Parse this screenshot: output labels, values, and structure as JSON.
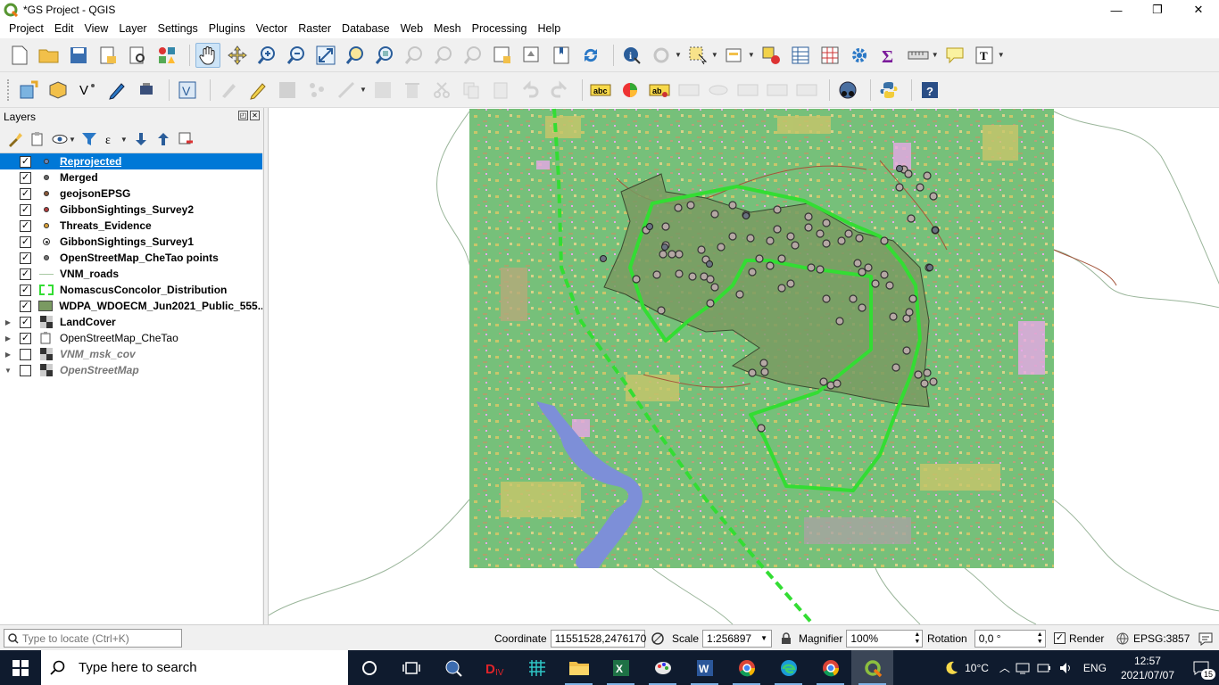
{
  "window": {
    "title": "*GS Project - QGIS",
    "minimize_glyph": "—",
    "maximize_glyph": "❐",
    "close_glyph": "✕"
  },
  "menubar": {
    "items": [
      "Project",
      "Edit",
      "View",
      "Layer",
      "Settings",
      "Plugins",
      "Vector",
      "Raster",
      "Database",
      "Web",
      "Mesh",
      "Processing",
      "Help"
    ]
  },
  "layers_panel": {
    "title": "Layers",
    "layers": [
      {
        "name": "Reprojected",
        "checked": true,
        "symbol": "dot",
        "color": "#6b86b6",
        "selected": true,
        "expander": ""
      },
      {
        "name": "Merged",
        "checked": true,
        "symbol": "dot",
        "color": "#6b6b6b",
        "expander": ""
      },
      {
        "name": "geojsonEPSG",
        "checked": true,
        "symbol": "dot",
        "color": "#8a5a3a",
        "expander": ""
      },
      {
        "name": "GibbonSightings_Survey2",
        "checked": true,
        "symbol": "dot",
        "color": "#b33d3d",
        "expander": ""
      },
      {
        "name": "Threats_Evidence",
        "checked": true,
        "symbol": "dot",
        "color": "#d9a13a",
        "expander": ""
      },
      {
        "name": "GibbonSightings_Survey1",
        "checked": true,
        "symbol": "ring",
        "color": "#555555",
        "expander": ""
      },
      {
        "name": "OpenStreetMap_CheTao points",
        "checked": true,
        "symbol": "dot",
        "color": "#777777",
        "expander": ""
      },
      {
        "name": "VNM_roads",
        "checked": true,
        "symbol": "line",
        "color": "#a9c9a4",
        "expander": ""
      },
      {
        "name": "NomascusConcolor_Distribution",
        "checked": true,
        "symbol": "dashbox",
        "color": "#33dd33",
        "expander": ""
      },
      {
        "name": "WDPA_WDOECM_Jun2021_Public_555...",
        "checked": true,
        "symbol": "fillbox",
        "color": "#7a9a62",
        "expander": ""
      },
      {
        "name": "LandCover",
        "checked": true,
        "symbol": "raster",
        "color": "#333333",
        "expander": "▶"
      },
      {
        "name": "OpenStreetMap_CheTao",
        "checked": true,
        "symbol": "group",
        "color": "#333333",
        "expander": "▶",
        "normal": true
      },
      {
        "name": "VNM_msk_cov",
        "checked": false,
        "symbol": "raster",
        "color": "#333333",
        "expander": "▶",
        "italic": true
      },
      {
        "name": "OpenStreetMap",
        "checked": false,
        "symbol": "raster",
        "color": "#333333",
        "expander": "▼",
        "italic": true
      }
    ]
  },
  "statusbar": {
    "locate_placeholder": "Type to locate (Ctrl+K)",
    "coordinate_label": "Coordinate",
    "coordinate_value": "11551528,2476170",
    "scale_label": "Scale",
    "scale_value": "1:256897",
    "magnifier_label": "Magnifier",
    "magnifier_value": "100%",
    "rotation_label": "Rotation",
    "rotation_value": "0,0 °",
    "render_label": "Render",
    "render_checked": true,
    "crs_label": "EPSG:3857"
  },
  "taskbar": {
    "search_placeholder": "Type here to search",
    "temperature": "10°C",
    "language": "ENG",
    "time": "12:57",
    "date": "2021/07/07",
    "notification_count": "15"
  },
  "colors": {
    "selection": "#0078d7",
    "landcover_green": "#76c07a",
    "protected_area": "#7a9a62",
    "distribution_line": "#33dd33",
    "water": "#7d8fd8"
  }
}
